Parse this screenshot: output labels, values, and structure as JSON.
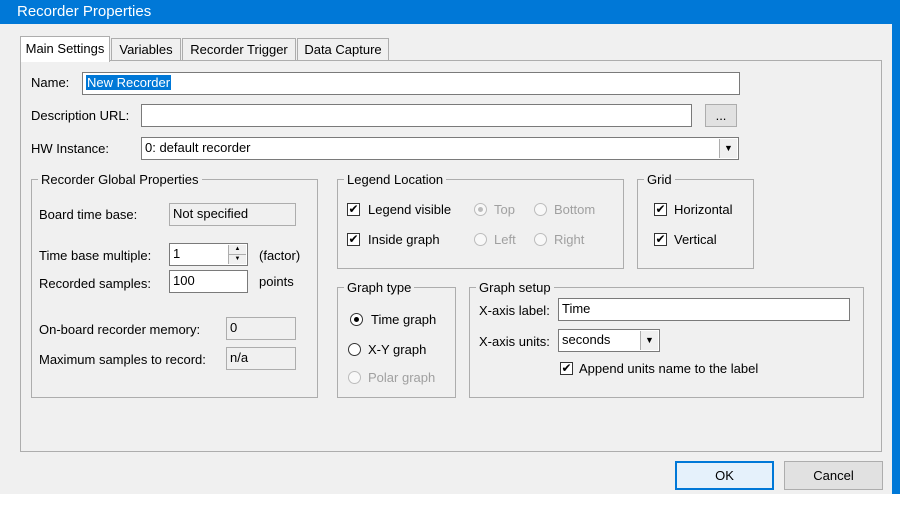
{
  "window": {
    "title": "Recorder Properties"
  },
  "tabs": [
    {
      "label": "Main Settings",
      "active": true
    },
    {
      "label": "Variables",
      "active": false
    },
    {
      "label": "Recorder Trigger",
      "active": false
    },
    {
      "label": "Data Capture",
      "active": false
    }
  ],
  "main": {
    "name_label": "Name:",
    "name_value": "New Recorder",
    "desc_label": "Description URL:",
    "desc_value": "",
    "browse_label": "...",
    "hw_label": "HW Instance:",
    "hw_value": "0: default recorder"
  },
  "global_props": {
    "legend": "Recorder Global Properties",
    "board_time_base_label": "Board time base:",
    "board_time_base_value": "Not specified",
    "time_base_multiple_label": "Time base multiple:",
    "time_base_multiple_value": "1",
    "time_base_multiple_unit": "(factor)",
    "recorded_samples_label": "Recorded samples:",
    "recorded_samples_value": "100",
    "recorded_samples_unit": "points",
    "onboard_memory_label": "On-board recorder memory:",
    "onboard_memory_value": "0",
    "max_samples_label": "Maximum samples to record:",
    "max_samples_value": "n/a"
  },
  "legend_location": {
    "legend": "Legend Location",
    "legend_visible": "Legend visible",
    "inside_graph": "Inside graph",
    "top": "Top",
    "bottom": "Bottom",
    "left": "Left",
    "right": "Right"
  },
  "grid": {
    "legend": "Grid",
    "horizontal": "Horizontal",
    "vertical": "Vertical"
  },
  "graph_type": {
    "legend": "Graph type",
    "time_graph": "Time graph",
    "xy_graph": "X-Y graph",
    "polar_graph": "Polar graph"
  },
  "graph_setup": {
    "legend": "Graph setup",
    "x_axis_label_label": "X-axis label:",
    "x_axis_label_value": "Time",
    "x_axis_units_label": "X-axis units:",
    "x_axis_units_value": "seconds",
    "append_units": "Append units name to the label"
  },
  "buttons": {
    "ok": "OK",
    "cancel": "Cancel"
  },
  "colors": {
    "titlebar": "#0078d7",
    "selection": "#0078d7",
    "face": "#f0f0f0"
  }
}
